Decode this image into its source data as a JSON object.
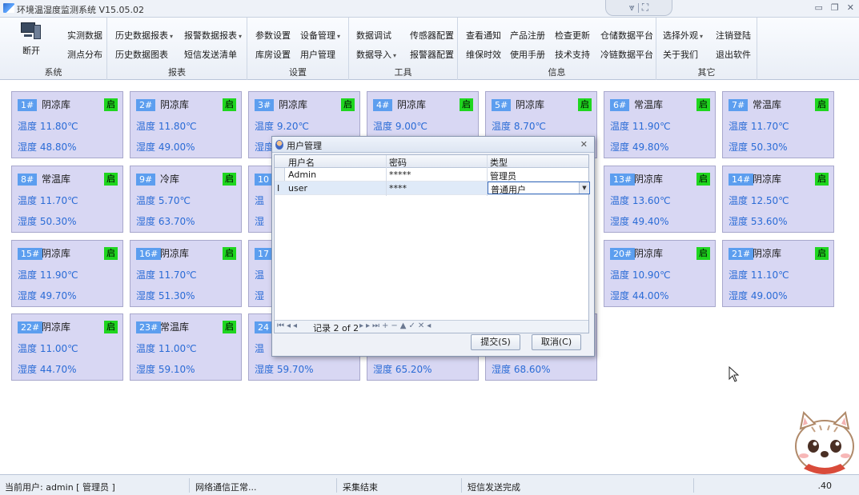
{
  "window": {
    "title": "环境温湿度监测系统 V15.05.02",
    "center_icons": [
      "signal-icon",
      "grid-icon"
    ],
    "controls": [
      "minimize-icon",
      "restore-icon",
      "close-icon"
    ]
  },
  "ribbon": {
    "groups": [
      {
        "label": "系统",
        "buttons": [
          "断开",
          "实测数据",
          "测点分布"
        ]
      },
      {
        "label": "报表",
        "buttons": [
          "历史数据报表",
          "报警数据报表",
          "历史数据图表",
          "短信发送清单"
        ]
      },
      {
        "label": "设置",
        "buttons": [
          "参数设置",
          "设备管理",
          "库房设置",
          "用户管理"
        ]
      },
      {
        "label": "工具",
        "buttons": [
          "数据调试",
          "传感器配置",
          "数据导入",
          "报警器配置"
        ]
      },
      {
        "label": "信息",
        "buttons": [
          "查看通知",
          "产品注册",
          "检查更新",
          "仓储数据平台",
          "维保时效",
          "使用手册",
          "技术支持",
          "冷链数据平台"
        ]
      },
      {
        "label": "其它",
        "buttons": [
          "选择外观",
          "注销登陆",
          "关于我们",
          "退出软件"
        ]
      }
    ]
  },
  "cards": [
    {
      "num": "1#",
      "name": "阴凉库",
      "badge": "启",
      "temp": "温度 11.80℃",
      "hum": "湿度 48.80%"
    },
    {
      "num": "2#",
      "name": "阴凉库",
      "badge": "启",
      "temp": "温度 11.80℃",
      "hum": "湿度 49.00%"
    },
    {
      "num": "3#",
      "name": "阴凉库",
      "badge": "启",
      "temp": "温度 9.20℃",
      "hum": "湿度"
    },
    {
      "num": "4#",
      "name": "阴凉库",
      "badge": "启",
      "temp": "温度 9.00℃",
      "hum": ""
    },
    {
      "num": "5#",
      "name": "阴凉库",
      "badge": "启",
      "temp": "温度 8.70℃",
      "hum": ""
    },
    {
      "num": "6#",
      "name": "常温库",
      "badge": "启",
      "temp": "温度 11.90℃",
      "hum": "湿度 49.80%"
    },
    {
      "num": "7#",
      "name": "常温库",
      "badge": "启",
      "temp": "温度 11.70℃",
      "hum": "湿度 50.30%"
    },
    {
      "num": "8#",
      "name": "常温库",
      "badge": "启",
      "temp": "温度 11.70℃",
      "hum": "湿度 50.30%"
    },
    {
      "num": "9#",
      "name": "冷库",
      "badge": "启",
      "temp": "温度 5.70℃",
      "hum": "湿度 63.70%"
    },
    {
      "num": "10",
      "name": "",
      "badge": "",
      "temp": "温",
      "hum": "湿"
    },
    {
      "num": "13#",
      "name": "阴凉库",
      "badge": "启",
      "temp": "温度 13.60℃",
      "hum": "湿度 49.40%"
    },
    {
      "num": "14#",
      "name": "阴凉库",
      "badge": "启",
      "temp": "温度 12.50℃",
      "hum": "湿度 53.60%"
    },
    {
      "num": "15#",
      "name": "阴凉库",
      "badge": "启",
      "temp": "温度 11.90℃",
      "hum": "湿度 49.70%"
    },
    {
      "num": "16#",
      "name": "阴凉库",
      "badge": "启",
      "temp": "温度 11.70℃",
      "hum": "湿度 51.30%"
    },
    {
      "num": "17",
      "name": "",
      "badge": "",
      "temp": "温",
      "hum": "湿"
    },
    {
      "num": "20#",
      "name": "阴凉库",
      "badge": "启",
      "temp": "温度 10.90℃",
      "hum": "湿度 44.00%"
    },
    {
      "num": "21#",
      "name": "阴凉库",
      "badge": "启",
      "temp": "温度 11.10℃",
      "hum": "湿度 49.00%"
    },
    {
      "num": "22#",
      "name": "阴凉库",
      "badge": "启",
      "temp": "温度 11.00℃",
      "hum": "湿度 44.70%"
    },
    {
      "num": "23#",
      "name": "常温库",
      "badge": "启",
      "temp": "温度 11.00℃",
      "hum": "湿度 59.10%"
    },
    {
      "num": "24",
      "name": "",
      "badge": "",
      "temp": "温",
      "hum": "湿度 59.70%"
    },
    {
      "num": "",
      "name": "",
      "badge": "",
      "temp": "",
      "hum": "湿度 65.20%"
    },
    {
      "num": "",
      "name": "",
      "badge": "",
      "temp": "",
      "hum": "湿度 68.60%"
    }
  ],
  "dialog": {
    "title": "用户管理",
    "columns": [
      "用户名",
      "密码",
      "类型"
    ],
    "rows": [
      {
        "user": "Admin",
        "password": "*****",
        "type": "管理员"
      },
      {
        "user": "user",
        "password": "****",
        "type": "普通用户"
      }
    ],
    "row_indicator": "I",
    "nav_text": "记录 2 of 2",
    "submit": "提交(S)",
    "cancel": "取消(C)"
  },
  "status": {
    "user": "当前用户: admin [ 管理员 ]",
    "network": "网络通信正常...",
    "collect": "采集结束",
    "sms": "短信发送完成",
    "right": ".40"
  },
  "colors": {
    "card_bg": "#d8d7f3",
    "num_bg": "#5c9eef",
    "badge_bg": "#1fd61f",
    "value_text": "#2a6bd6"
  }
}
